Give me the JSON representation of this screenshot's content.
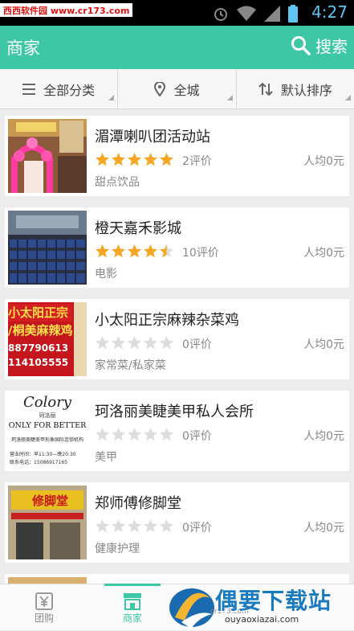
{
  "status_bar": {
    "watermark": "西西软件园 www.cr173.com",
    "time": "4:27"
  },
  "app_bar": {
    "title": "商家",
    "search_label": "搜索"
  },
  "filters": [
    {
      "label": "全部分类",
      "icon": "menu-icon"
    },
    {
      "label": "全城",
      "icon": "location-pin-icon"
    },
    {
      "label": "默认排序",
      "icon": "sort-icon"
    }
  ],
  "merchants": [
    {
      "name": "湄潭喇叭团活动站",
      "rating": 5,
      "reviews": "2评价",
      "avg_price": "人均0元",
      "category": "甜点饮品"
    },
    {
      "name": "橙天嘉禾影城",
      "rating": 4.5,
      "reviews": "10评价",
      "avg_price": "人均0元",
      "category": "电影"
    },
    {
      "name": "小太阳正宗麻辣杂菜鸡",
      "rating": 0,
      "reviews": "0评价",
      "avg_price": "人均0元",
      "category": "家常菜/私家菜"
    },
    {
      "name": "珂洛丽美睫美甲私人会所",
      "rating": 0,
      "reviews": "0评价",
      "avg_price": "人均0元",
      "category": "美甲"
    },
    {
      "name": "郑师傅修脚堂",
      "rating": 0,
      "reviews": "0评价",
      "avg_price": "人均0元",
      "category": "健康护理"
    }
  ],
  "thumbnails": {
    "t3_line1": "小太阳正宗",
    "t3_line2": "/桐美麻辣鸡",
    "t3_line3": "887790613",
    "t3_line4": "114105555",
    "t4_logo": "Colory",
    "t4_sub": "珂洛丽",
    "t4_slogan": "ONLY FOR BETTER",
    "t4_line1": "珂洛丽美睫美甲形象国际连锁机构",
    "t4_line2": "营业时间：早11:30—晚20:30",
    "t4_line3": "联系电话：15086917165",
    "t5_sign": "修脚堂"
  },
  "tabs": [
    {
      "label": "团购",
      "icon": "groupon-yen-icon",
      "active": false
    },
    {
      "label": "商家",
      "icon": "shop-icon",
      "active": true
    }
  ],
  "watermark_overlay": {
    "title": "偶要下载站",
    "url": "ouyaoxiazai.com",
    "small": "cr173.com"
  },
  "colors": {
    "accent": "#3ec7a5",
    "star_filled": "#f5a623",
    "star_empty": "#dddddd"
  }
}
